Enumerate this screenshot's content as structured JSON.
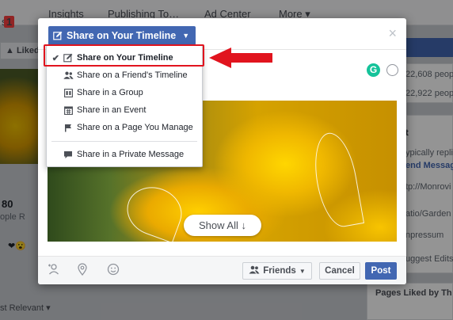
{
  "background": {
    "topnav": {
      "items": [
        "s",
        "Insights",
        "Publishing To…",
        "Ad Center",
        "More ▾"
      ],
      "badge": "1"
    },
    "liked_button": "Liked",
    "left_snippets": [
      "80",
      "ople R"
    ],
    "left_reactions": "❤😮",
    "right_snippets": [
      "22,608 peop",
      "22,922 peop",
      "t",
      "ypically repli",
      "end Messag",
      "tp://Monrovi",
      "atio/Garden",
      "npressum",
      "uggest Edits"
    ],
    "pages_liked": "Pages Liked by Th",
    "most_relevant": "st Relevant ▾"
  },
  "modal": {
    "header_dropdown_label": "Share on Your Timeline",
    "close_label": "×",
    "grammarly_label": "G",
    "show_all_label": "Show All ↓",
    "footer": {
      "friends_label": "Friends",
      "cancel_label": "Cancel",
      "post_label": "Post"
    }
  },
  "share_menu": {
    "items": [
      {
        "label": "Share on Your Timeline",
        "icon": "edit-icon",
        "selected": true
      },
      {
        "label": "Share on a Friend's Timeline",
        "icon": "friends-icon",
        "selected": false
      },
      {
        "label": "Share in a Group",
        "icon": "group-icon",
        "selected": false
      },
      {
        "label": "Share in an Event",
        "icon": "calendar-icon",
        "selected": false
      },
      {
        "label": "Share on a Page You Manage",
        "icon": "flag-icon",
        "selected": false
      },
      {
        "label": "Share in a Private Message",
        "icon": "message-icon",
        "selected": false
      }
    ],
    "check_glyph": "✔"
  },
  "colors": {
    "facebook_blue": "#4267b2",
    "highlight_red": "#e1141e",
    "grammarly_green": "#15c39a"
  }
}
